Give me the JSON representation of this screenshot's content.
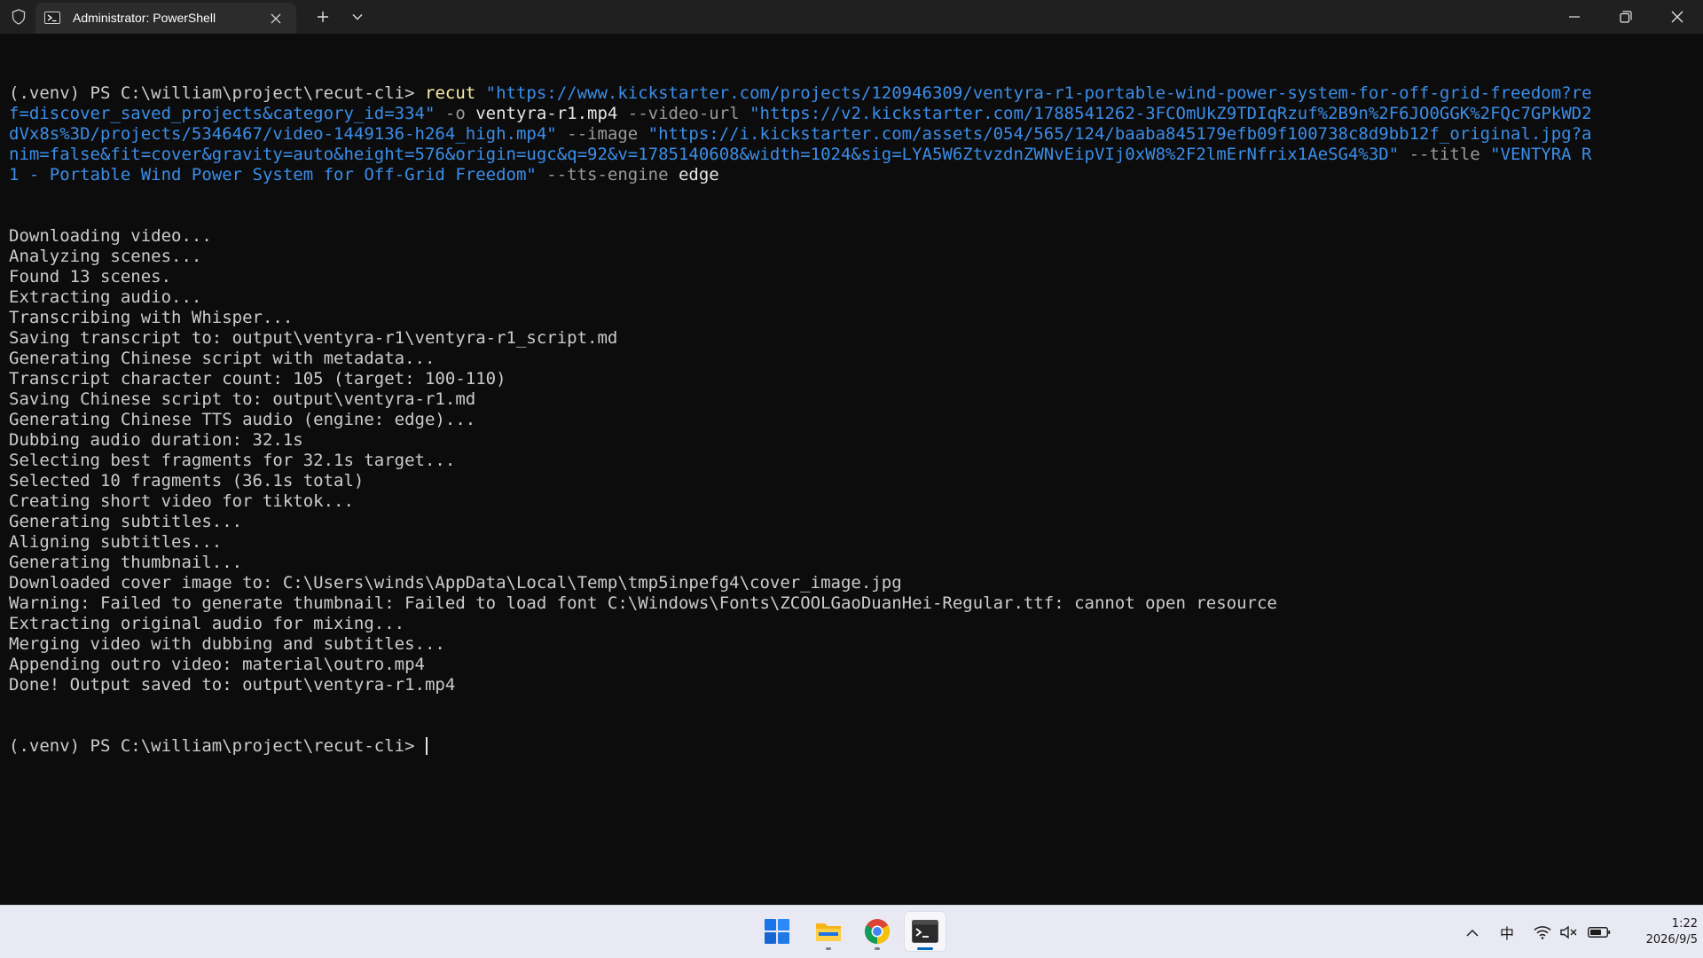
{
  "window": {
    "tab_title": "Administrator: PowerShell",
    "icons": {
      "shield": "shield-icon",
      "tab": "powershell-icon",
      "tab_close": "close-icon",
      "new_tab": "plus-icon",
      "dropdown": "chevron-down-icon",
      "minimize": "minimize-icon",
      "maximize": "restore-icon",
      "close": "close-icon"
    }
  },
  "terminal": {
    "colors": {
      "background": "#0c0c0c",
      "text": "#cccccc",
      "command": "#f9f1a5",
      "string": "#3b8eea",
      "parameter": "#9a9a9a"
    },
    "command_lines": [
      [
        {
          "text": "(.venv) PS C:\\william\\project\\recut-cli> ",
          "style": "plain"
        },
        {
          "text": "recut",
          "style": "yellow"
        },
        {
          "text": " ",
          "style": "plain"
        },
        {
          "text": "\"https://www.kickstarter.com/projects/120946309/ventyra-r1-portable-wind-power-system-for-off-grid-freedom?re",
          "style": "blue"
        }
      ],
      [
        {
          "text": "f=discover_saved_projects&category_id=334\"",
          "style": "blue"
        },
        {
          "text": " -o ",
          "style": "gray"
        },
        {
          "text": "ventyra-r1.mp4",
          "style": "white"
        },
        {
          "text": " --video-url ",
          "style": "gray"
        },
        {
          "text": "\"https://v2.kickstarter.com/1788541262-3FCOmUkZ9TDIqRzuf%2B9n%2F6JO0GGK%2FQc7GPkWD2",
          "style": "blue"
        }
      ],
      [
        {
          "text": "dVx8s%3D/projects/5346467/video-1449136-h264_high.mp4\"",
          "style": "blue"
        },
        {
          "text": " --image ",
          "style": "gray"
        },
        {
          "text": "\"https://i.kickstarter.com/assets/054/565/124/baaba845179efb09f100738c8d9bb12f_original.jpg?a",
          "style": "blue"
        }
      ],
      [
        {
          "text": "nim=false&fit=cover&gravity=auto&height=576&origin=ugc&q=92&v=1785140608&width=1024&sig=LYA5W6ZtvzdnZWNvEipVIj0xW8%2F2lmErNfrix1AeSG4%3D\"",
          "style": "blue"
        },
        {
          "text": " --title ",
          "style": "gray"
        },
        {
          "text": "\"VENTYRA R",
          "style": "blue"
        }
      ],
      [
        {
          "text": "1 - Portable Wind Power System for Off-Grid Freedom\"",
          "style": "blue"
        },
        {
          "text": " --tts-engine ",
          "style": "gray"
        },
        {
          "text": "edge",
          "style": "white"
        }
      ]
    ],
    "output_lines": [
      "Downloading video...",
      "Analyzing scenes...",
      "Found 13 scenes.",
      "Extracting audio...",
      "Transcribing with Whisper...",
      "Saving transcript to: output\\ventyra-r1\\ventyra-r1_script.md",
      "Generating Chinese script with metadata...",
      "Transcript character count: 105 (target: 100-110)",
      "Saving Chinese script to: output\\ventyra-r1.md",
      "Generating Chinese TTS audio (engine: edge)...",
      "Dubbing audio duration: 32.1s",
      "Selecting best fragments for 32.1s target...",
      "Selected 10 fragments (36.1s total)",
      "Creating short video for tiktok...",
      "Generating subtitles...",
      "Aligning subtitles...",
      "Generating thumbnail...",
      "Downloaded cover image to: C:\\Users\\winds\\AppData\\Local\\Temp\\tmp5inpefg4\\cover_image.jpg",
      "Warning: Failed to generate thumbnail: Failed to load font C:\\Windows\\Fonts\\ZCOOLGaoDuanHei-Regular.ttf: cannot open resource",
      "Extracting original audio for mixing...",
      "Merging video with dubbing and subtitles...",
      "Appending outro video: material\\outro.mp4",
      "Done! Output saved to: output\\ventyra-r1.mp4"
    ],
    "prompt": "(.venv) PS C:\\william\\project\\recut-cli> "
  },
  "taskbar": {
    "apps": [
      {
        "name": "start-icon",
        "active": false,
        "running": false
      },
      {
        "name": "file-explorer-icon",
        "active": false,
        "running": true
      },
      {
        "name": "chrome-icon",
        "active": false,
        "running": true
      },
      {
        "name": "terminal-icon",
        "active": true,
        "running": true
      }
    ],
    "tray": {
      "chevron": "chevron-up-icon",
      "ime": "中",
      "wifi": "wifi-icon",
      "volume": "volume-muted-icon",
      "battery": "battery-icon"
    },
    "time": "1:22",
    "date": "2026/9/5"
  }
}
